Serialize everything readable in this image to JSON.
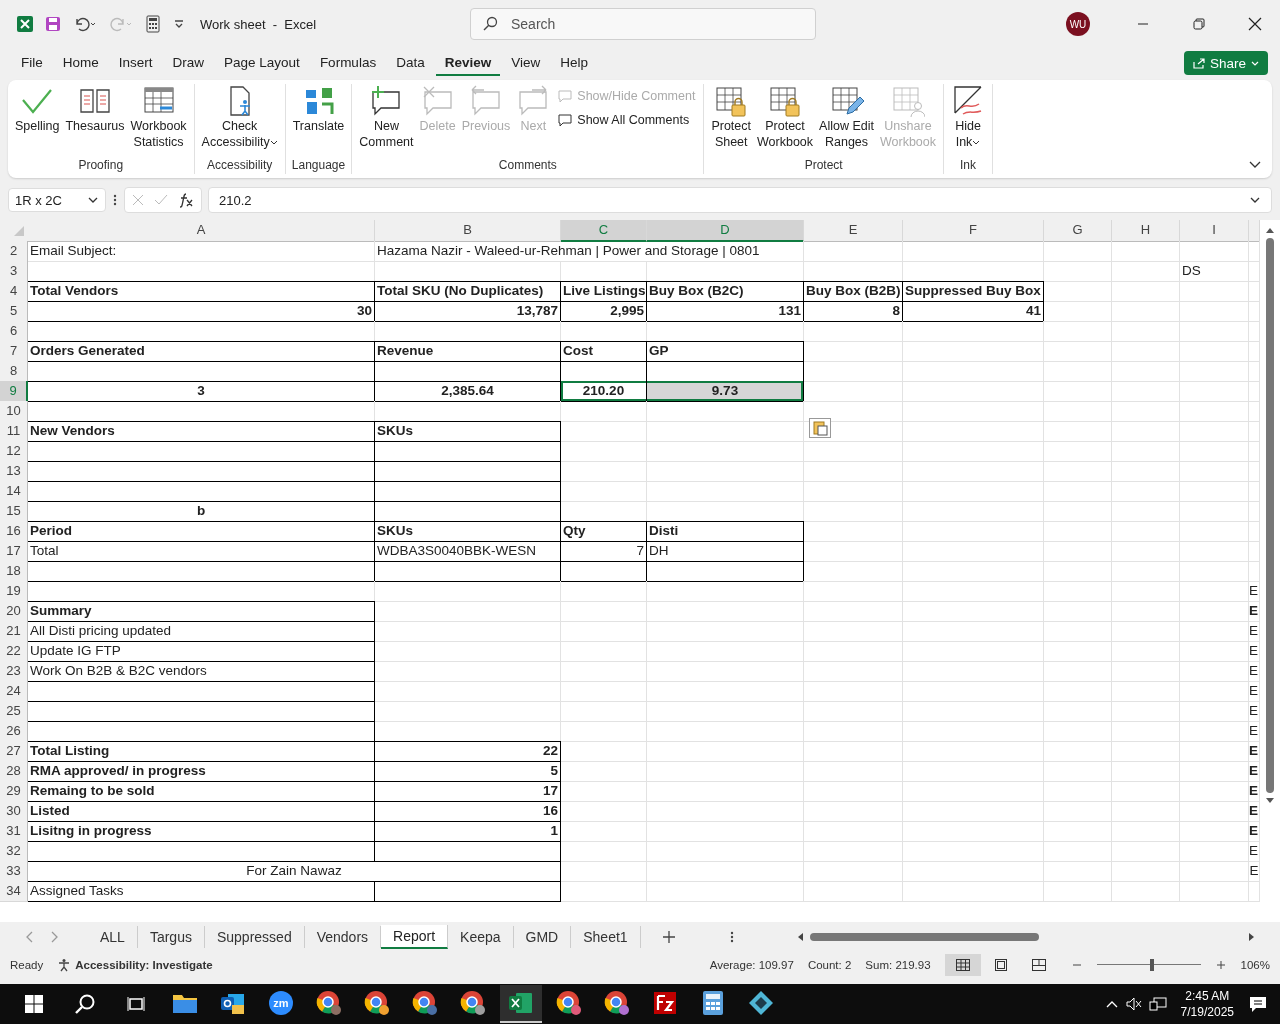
{
  "titlebar": {
    "title": "Work sheet  -  Excel",
    "search_placeholder": "Search",
    "avatar": "WU"
  },
  "menu_tabs": [
    {
      "label": "File",
      "selected": false
    },
    {
      "label": "Home",
      "selected": false
    },
    {
      "label": "Insert",
      "selected": false
    },
    {
      "label": "Draw",
      "selected": false
    },
    {
      "label": "Page Layout",
      "selected": false
    },
    {
      "label": "Formulas",
      "selected": false
    },
    {
      "label": "Data",
      "selected": false
    },
    {
      "label": "Review",
      "selected": true
    },
    {
      "label": "View",
      "selected": false
    },
    {
      "label": "Help",
      "selected": false
    }
  ],
  "share": "Share",
  "ribbon_groups": [
    {
      "name": "Proofing",
      "items": [
        {
          "kind": "large",
          "label": "Spelling",
          "disabled": false
        },
        {
          "kind": "large",
          "label": "Thesaurus",
          "disabled": false
        },
        {
          "kind": "large",
          "label": "Workbook\nStatistics",
          "disabled": false
        }
      ]
    },
    {
      "name": "Accessibility",
      "items": [
        {
          "kind": "large",
          "label": "Check\nAccessibility",
          "dropdown": true,
          "disabled": false
        }
      ]
    },
    {
      "name": "Language",
      "items": [
        {
          "kind": "large",
          "label": "Translate",
          "disabled": false
        }
      ]
    },
    {
      "name": "Comments",
      "items": [
        {
          "kind": "large",
          "label": "New\nComment",
          "disabled": false
        },
        {
          "kind": "large",
          "label": "Delete",
          "disabled": true
        },
        {
          "kind": "large",
          "label": "Previous",
          "disabled": true
        },
        {
          "kind": "large",
          "label": "Next",
          "disabled": true
        },
        {
          "kind": "small",
          "label": "Show/Hide Comment",
          "disabled": true
        },
        {
          "kind": "small",
          "label": "Show All Comments",
          "disabled": false
        }
      ]
    },
    {
      "name": "Protect",
      "items": [
        {
          "kind": "large",
          "label": "Protect\nSheet",
          "disabled": false
        },
        {
          "kind": "large",
          "label": "Protect\nWorkbook",
          "disabled": false
        },
        {
          "kind": "large",
          "label": "Allow Edit\nRanges",
          "disabled": false
        },
        {
          "kind": "large",
          "label": "Unshare\nWorkbook",
          "disabled": true
        }
      ]
    },
    {
      "name": "Ink",
      "items": [
        {
          "kind": "large",
          "label": "Hide\nInk",
          "dropdown": true,
          "disabled": false
        }
      ]
    }
  ],
  "formula_bar": {
    "name_box": "1R x 2C",
    "formula": "210.2"
  },
  "sheet": {
    "columns": [
      {
        "label": "A",
        "selected": false
      },
      {
        "label": "B",
        "selected": false
      },
      {
        "label": "C",
        "selected": true
      },
      {
        "label": "D",
        "selected": true
      },
      {
        "label": "E",
        "selected": false
      },
      {
        "label": "F",
        "selected": false
      },
      {
        "label": "G",
        "selected": false
      },
      {
        "label": "H",
        "selected": false
      },
      {
        "label": "I",
        "selected": false
      }
    ],
    "rows": [
      {
        "n": "2",
        "selected": false,
        "cells": {
          "A": "Email Subject:",
          "B": "Hazama Nazir - Waleed-ur-Rehman | Power and Storage | 0801"
        }
      },
      {
        "n": "3",
        "selected": false,
        "cells": {
          "I": "DS"
        }
      },
      {
        "n": "4",
        "selected": false,
        "cells": {
          "A": "Total Vendors",
          "B": "Total SKU (No Duplicates)",
          "C": "Live Listings",
          "D": "Buy Box (B2C)",
          "E": "Buy Box (B2B)",
          "F": "Suppressed Buy Box"
        }
      },
      {
        "n": "5",
        "selected": false,
        "cells": {
          "A": "30",
          "B": "13,787",
          "C": "2,995",
          "D": "131",
          "E": "8",
          "F": "41"
        }
      },
      {
        "n": "6",
        "selected": false,
        "cells": {}
      },
      {
        "n": "7",
        "selected": false,
        "cells": {
          "A": "Orders Generated",
          "B": "Revenue",
          "C": "Cost",
          "D": "GP"
        }
      },
      {
        "n": "8",
        "selected": false,
        "cells": {}
      },
      {
        "n": "9",
        "selected": true,
        "cells": {
          "A": "3",
          "B": "2,385.64",
          "C": "210.20",
          "D": "9.73"
        }
      },
      {
        "n": "10",
        "selected": false,
        "cells": {}
      },
      {
        "n": "11",
        "selected": false,
        "cells": {
          "A": "New Vendors",
          "B": "SKUs"
        }
      },
      {
        "n": "12",
        "selected": false,
        "cells": {}
      },
      {
        "n": "13",
        "selected": false,
        "cells": {}
      },
      {
        "n": "14",
        "selected": false,
        "cells": {}
      },
      {
        "n": "15",
        "selected": false,
        "cells": {
          "A": "b"
        }
      },
      {
        "n": "16",
        "selected": false,
        "cells": {
          "A": "Period",
          "B": "SKUs",
          "C": "Qty",
          "D": "Disti"
        }
      },
      {
        "n": "17",
        "selected": false,
        "cells": {
          "A": "Total",
          "B": "WDBA3S0040BBK-WESN",
          "C": "7",
          "D": "DH"
        }
      },
      {
        "n": "18",
        "selected": false,
        "cells": {}
      },
      {
        "n": "19",
        "selected": false,
        "cells": {
          "J": "E"
        }
      },
      {
        "n": "20",
        "selected": false,
        "cells": {
          "A": "Summary",
          "J": "E"
        }
      },
      {
        "n": "21",
        "selected": false,
        "cells": {
          "A": "All Disti pricing updated",
          "J": "E"
        }
      },
      {
        "n": "22",
        "selected": false,
        "cells": {
          "A": "Update IG FTP",
          "J": "E"
        }
      },
      {
        "n": "23",
        "selected": false,
        "cells": {
          "A": "Work On B2B & B2C vendors",
          "J": "E"
        }
      },
      {
        "n": "24",
        "selected": false,
        "cells": {
          "J": "E"
        }
      },
      {
        "n": "25",
        "selected": false,
        "cells": {
          "J": "E"
        }
      },
      {
        "n": "26",
        "selected": false,
        "cells": {
          "J": "E"
        }
      },
      {
        "n": "27",
        "selected": false,
        "cells": {
          "A": "Total Listing",
          "B": "22",
          "J": "E"
        }
      },
      {
        "n": "28",
        "selected": false,
        "cells": {
          "A": "RMA approved/ in progress",
          "B": "5",
          "J": "E"
        }
      },
      {
        "n": "29",
        "selected": false,
        "cells": {
          "A": "Remaing to be sold",
          "B": "17",
          "J": "E"
        }
      },
      {
        "n": "30",
        "selected": false,
        "cells": {
          "A": "Listed",
          "B": "16",
          "J": "E"
        }
      },
      {
        "n": "31",
        "selected": false,
        "cells": {
          "A": "Lisitng in progress",
          "B": "1",
          "J": "E"
        }
      },
      {
        "n": "32",
        "selected": false,
        "cells": {
          "J": "E"
        }
      },
      {
        "n": "33",
        "selected": false,
        "cells": {
          "A": "For Zain Nawaz",
          "J": "E"
        }
      },
      {
        "n": "34",
        "selected": false,
        "cells": {
          "A": "Assigned Tasks"
        }
      }
    ]
  },
  "sheet_tabs": [
    {
      "label": "ALL",
      "selected": false
    },
    {
      "label": "Targus",
      "selected": false
    },
    {
      "label": "Suppressed",
      "selected": false
    },
    {
      "label": "Vendors",
      "selected": false
    },
    {
      "label": "Report",
      "selected": true
    },
    {
      "label": "Keepa",
      "selected": false
    },
    {
      "label": "GMD",
      "selected": false
    },
    {
      "label": "Sheet1",
      "selected": false
    }
  ],
  "status_bar": {
    "ready": "Ready",
    "accessibility": "Accessibility: Investigate",
    "average": "Average: 109.97",
    "count": "Count: 2",
    "sum": "Sum: 219.93",
    "views": [
      {
        "kind": "normal",
        "selected": true
      },
      {
        "kind": "page-layout",
        "selected": false
      },
      {
        "kind": "page-break",
        "selected": false
      }
    ],
    "zoom": {
      "level": 0.53,
      "reading": "106%"
    }
  },
  "taskbar": {
    "apps": [
      {
        "kind": "folder",
        "active": false
      },
      {
        "kind": "mail",
        "active": false
      },
      {
        "kind": "video",
        "label": "zm",
        "active": false
      },
      {
        "kind": "browser",
        "color": "#8d6e63",
        "active": false
      },
      {
        "kind": "browser",
        "color": "#f0a030",
        "active": false
      },
      {
        "kind": "browser",
        "color": "#4a6fa5",
        "active": false
      },
      {
        "kind": "browser",
        "color": "#9e9e9e",
        "active": false
      },
      {
        "kind": "sheet",
        "active": true
      },
      {
        "kind": "browser",
        "color": "#e05a7a",
        "active": false
      },
      {
        "kind": "browser",
        "color": "#b070d0",
        "active": false
      },
      {
        "kind": "ftp",
        "active": false
      },
      {
        "kind": "calc",
        "active": false
      },
      {
        "kind": "diamond",
        "active": false
      }
    ],
    "time": "2:45 AM",
    "date": "7/19/2025"
  }
}
